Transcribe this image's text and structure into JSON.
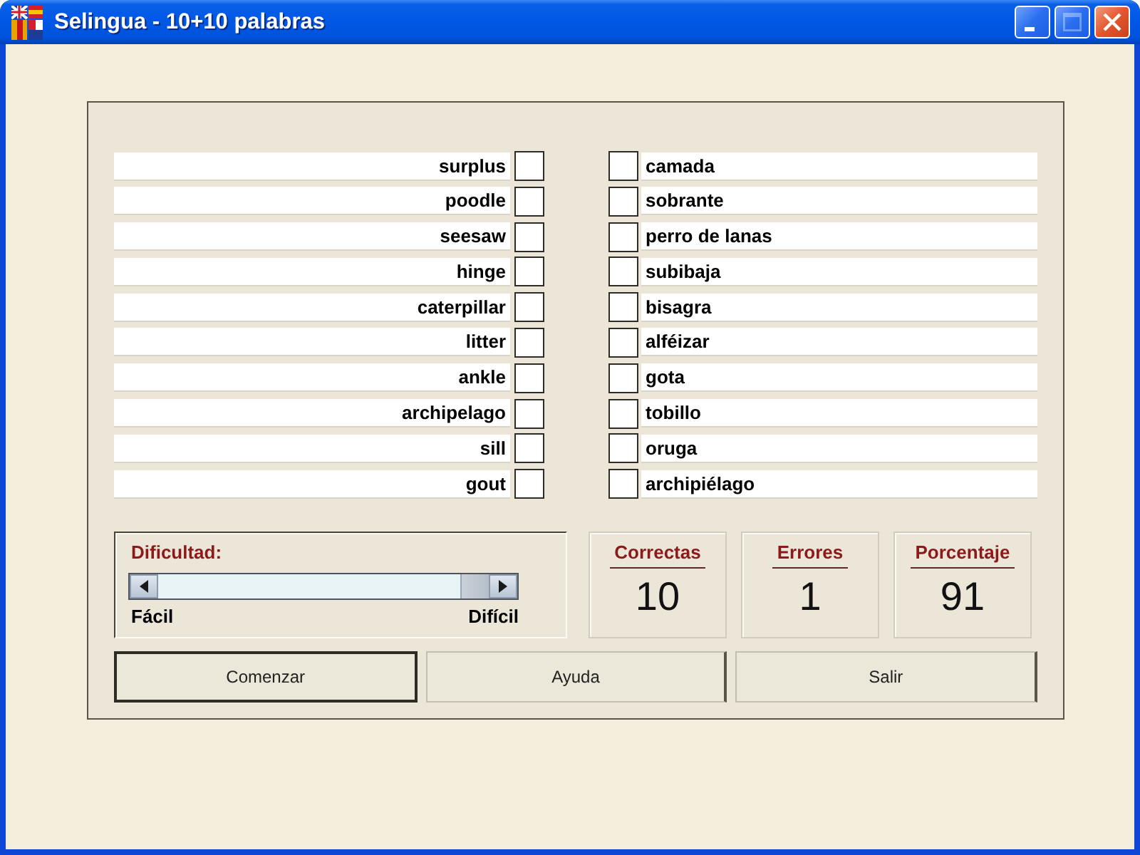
{
  "window": {
    "title": "Selingua - 10+10 palabras",
    "title_buttons": [
      {
        "kind": "minimize",
        "disabled": false
      },
      {
        "kind": "maximize",
        "disabled": true
      },
      {
        "kind": "close",
        "disabled": false
      }
    ]
  },
  "english_words": [
    {
      "text": "surplus",
      "checked": false
    },
    {
      "text": "poodle",
      "checked": false
    },
    {
      "text": "seesaw",
      "checked": false
    },
    {
      "text": "hinge",
      "checked": false
    },
    {
      "text": "caterpillar",
      "checked": false
    },
    {
      "text": "litter",
      "checked": false
    },
    {
      "text": "ankle",
      "checked": false
    },
    {
      "text": "archipelago",
      "checked": false
    },
    {
      "text": "sill",
      "checked": false
    },
    {
      "text": "gout",
      "checked": false
    }
  ],
  "spanish_words": [
    {
      "text": "camada",
      "checked": false
    },
    {
      "text": "sobrante",
      "checked": false
    },
    {
      "text": "perro de lanas",
      "checked": false
    },
    {
      "text": "subibaja",
      "checked": false
    },
    {
      "text": "bisagra",
      "checked": false
    },
    {
      "text": "alféizar",
      "checked": false
    },
    {
      "text": "gota",
      "checked": false
    },
    {
      "text": "tobillo",
      "checked": false
    },
    {
      "text": "oruga",
      "checked": false
    },
    {
      "text": "archipiélago",
      "checked": false
    }
  ],
  "difficulty": {
    "label": "Dificultad:",
    "level": 1,
    "min_label": "Fácil",
    "max_label": "Difícil"
  },
  "stats": [
    {
      "label": "Correctas",
      "value": "10"
    },
    {
      "label": "Errores",
      "value": "1"
    },
    {
      "label": "Porcentaje",
      "value": "91"
    }
  ],
  "buttons": [
    {
      "label": "Comenzar",
      "default": true
    },
    {
      "label": "Ayuda",
      "default": false
    },
    {
      "label": "Salir",
      "default": false
    }
  ]
}
